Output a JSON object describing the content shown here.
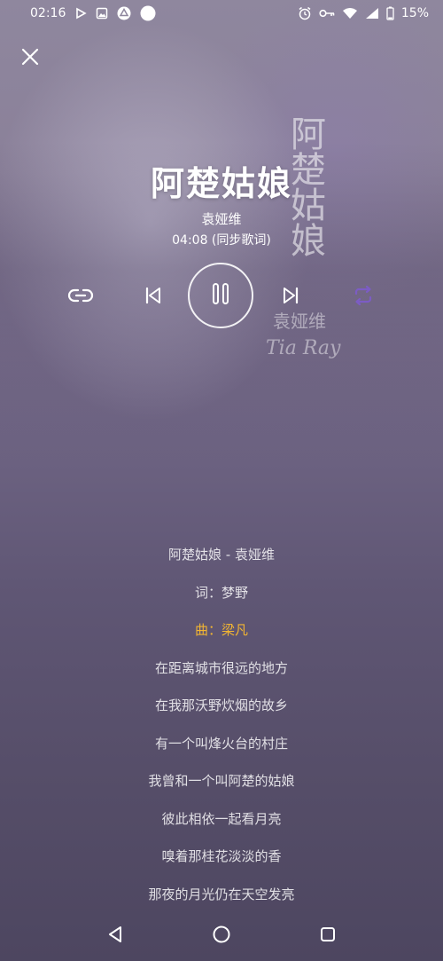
{
  "status_bar": {
    "time": "02:16",
    "battery": "15%",
    "icons": [
      "play-icon",
      "image-icon",
      "drive-icon",
      "dot-icon",
      "alarm-icon",
      "vpn-key-icon",
      "wifi-icon",
      "signal-icon",
      "battery-icon"
    ]
  },
  "artwork": {
    "vertical_title": "阿楚姑娘",
    "artist_text": "袁娅维",
    "signature": "Tia Ray"
  },
  "song": {
    "title": "阿楚姑娘",
    "artist": "袁娅维",
    "duration_info": "04:08 (同步歌词)"
  },
  "controls": {
    "icons": [
      "link-icon",
      "previous-icon",
      "pause-icon",
      "next-icon",
      "repeat-icon"
    ],
    "accent_color": "#7c5cc4"
  },
  "lyrics": {
    "active_index": 2,
    "active_color": "#f2b532",
    "lines": [
      "阿楚姑娘 - 袁娅维",
      "词：梦野",
      "曲：梁凡",
      "在距离城市很远的地方",
      "在我那沃野炊烟的故乡",
      "有一个叫烽火台的村庄",
      "我曾和一个叫阿楚的姑娘",
      "彼此相依一起看月亮",
      "嗅着那桂花淡淡的香",
      "那夜的月光仍在天空发亮"
    ]
  },
  "navbar": {
    "icons": [
      "back-icon",
      "home-icon",
      "recents-icon"
    ]
  }
}
